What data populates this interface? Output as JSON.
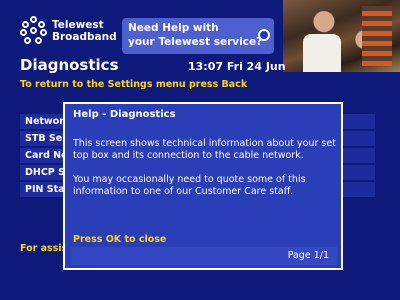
{
  "brand": {
    "line1": "Telewest",
    "line2": "Broadband"
  },
  "help_banner": {
    "line1": "Need Help with",
    "line2": "your Telewest service?"
  },
  "header": {
    "title": "Diagnostics",
    "clock": "13:07 Fri 24 Jun",
    "instruction": "To return to the Settings menu press Back"
  },
  "menu": {
    "items": [
      {
        "label": "Networ"
      },
      {
        "label": "STB Se"
      },
      {
        "label": "Card No"
      },
      {
        "label": "DHCP S"
      },
      {
        "label": "PIN Sta"
      }
    ]
  },
  "bottom_hint": "For assis",
  "dialog": {
    "title": "Help - Diagnostics",
    "para1": "This screen shows technical information about your set top box and its connection to the cable network.",
    "para2": "You may occasionally need to quote some of this information to one of our Customer Care staff.",
    "ok_hint": "Press OK to close",
    "pager": "Page 1/1"
  },
  "colors": {
    "background": "#0d1a7c",
    "dialog": "#2a3eb8",
    "accent_yellow": "#ffd21a",
    "banner": "#4e5fd0"
  },
  "icons": [
    "telewest-logo-icon",
    "help-button-icon"
  ]
}
